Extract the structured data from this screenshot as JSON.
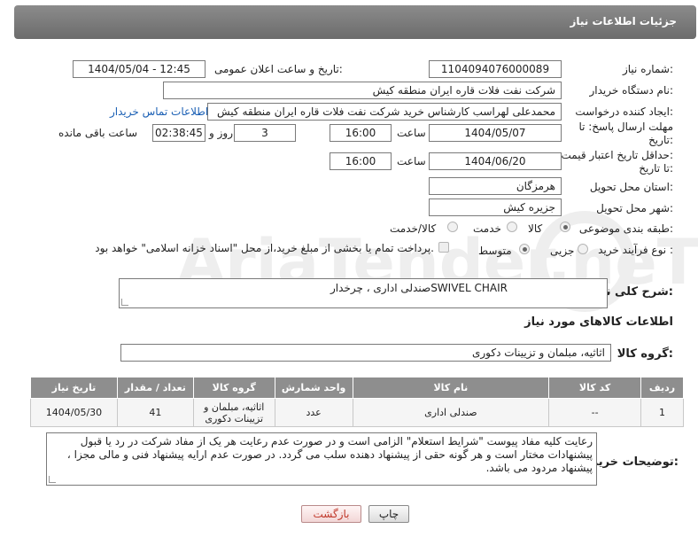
{
  "header": {
    "title": "جزئیات اطلاعات نیاز"
  },
  "labels": {
    "need_number": "شماره نیاز:",
    "announce_datetime": "تاریخ و ساعت اعلان عمومی:",
    "buyer_org": "نام دستگاه خریدار:",
    "requester": "ایجاد کننده درخواست:",
    "reply_deadline_line1": "مهلت ارسال پاسخ: تا",
    "reply_deadline_line2": "تاریخ:",
    "hour": "ساعت",
    "day_and": "روز و",
    "time_remaining": "ساعت باقی مانده",
    "price_validity_line1": "حداقل تاریخ اعتبار قیمت:",
    "price_validity_line2": "تا تاریخ:",
    "hour2": "ساعت",
    "delivery_province": "استان محل تحویل:",
    "delivery_city": "شهر محل تحویل:",
    "category": "طبقه بندی موضوعی:",
    "purchase_type": "نوع فرآیند خرید :",
    "description": "شرح کلی نیاز:",
    "items_info": "اطلاعات کالاهای مورد نیاز",
    "goods_group": "گروه کالا:",
    "buyer_notes": "توضیحات خریدار:"
  },
  "values": {
    "need_number": "1104094076000089",
    "announce_datetime": "1404/05/04 - 12:45",
    "buyer_org": "شرکت نفت فلات قاره ایران منطقه کیش",
    "requester": "محمدعلی لهراسب کارشناس خرید شرکت نفت فلات قاره ایران منطقه کیش",
    "buyer_contact_link": "اطلاعات تماس خریدار",
    "reply_date": "1404/05/07",
    "reply_time": "16:00",
    "reply_days": "3",
    "reply_remaining": "02:38:45",
    "price_date": "1404/06/20",
    "price_time": "16:00",
    "province": "هرمزگان",
    "city": "جزیره کیش",
    "description": "صندلی اداری ، چرخدارSWIVEL CHAIR",
    "goods_group": "اثاثیه، مبلمان و تزیینات دکوری",
    "buyer_notes": "رعایت کلیه مفاد  پیوست \"شرایط استعلام\" الزامی است و در صورت عدم رعایت هر یک از مفاد شرکت در رد یا قبول پیشنهادات مختار است  و هر گونه حقی از پیشنهاد دهنده سلب می گردد. در صورت عدم ارایه پیشنهاد فنی و مالی مجزا ، پیشنهاد مردود می باشد."
  },
  "category_options": [
    {
      "label": "کالا",
      "selected": true
    },
    {
      "label": "خدمت",
      "selected": false
    },
    {
      "label": "کالا/خدمت",
      "selected": false
    }
  ],
  "purchase_options": [
    {
      "label": "جزیی",
      "selected": false
    },
    {
      "label": "متوسط",
      "selected": true
    }
  ],
  "payment_note": "پرداخت تمام یا بخشی از مبلغ خرید،از محل \"اسناد خزانه اسلامی\" خواهد بود.",
  "table": {
    "headers": [
      "ردیف",
      "کد کالا",
      "نام کالا",
      "واحد شمارش",
      "گروه کالا",
      "تعداد / مقدار",
      "تاریخ نیاز"
    ],
    "rows": [
      [
        "1",
        "--",
        "صندلی اداری",
        "عدد",
        "اثاثیه، مبلمان و تزیینات دکوری",
        "41",
        "1404/05/30"
      ]
    ]
  },
  "buttons": {
    "print": "چاپ",
    "back": "بازگشت"
  },
  "watermark_text": "AriaTender.neT",
  "colors": {
    "header_bg": "#7a7a7a",
    "link": "#1a5fb4",
    "back_button": "#c0392b"
  }
}
